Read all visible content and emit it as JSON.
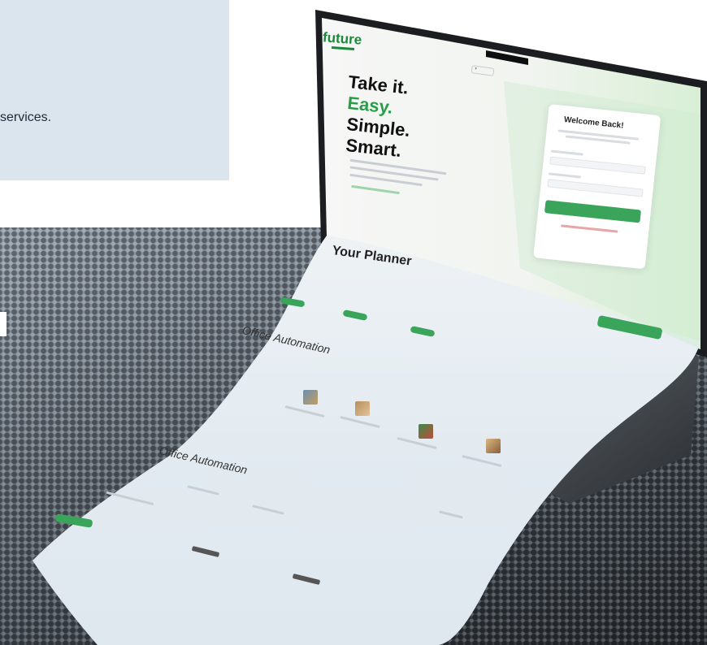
{
  "panel": {
    "text": "services."
  },
  "screen": {
    "logo": "future",
    "hero": [
      "Take it.",
      "Easy.",
      "Simple.",
      "Smart."
    ],
    "welcome_title": "Welcome Back!",
    "planner_title": "Your Planner",
    "section_1": "Office Automation",
    "section_2": "Office Automation"
  },
  "colors": {
    "brand_green": "#2a9d49",
    "panel_bg": "#dbe5ed"
  }
}
